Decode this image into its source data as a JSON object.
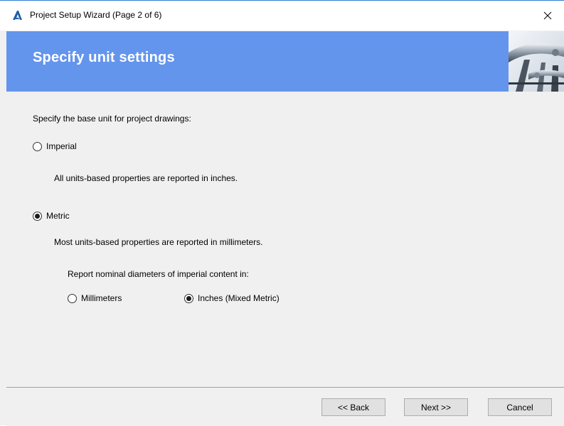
{
  "window": {
    "title": "Project Setup Wizard (Page 2 of 6)",
    "close_glyph": "✕"
  },
  "banner": {
    "title": "Specify unit settings"
  },
  "content": {
    "prompt": "Specify the base unit for project drawings:",
    "imperial": {
      "label": "Imperial",
      "checked": false,
      "description": "All units-based properties are reported in inches."
    },
    "metric": {
      "label": "Metric",
      "checked": true,
      "description": "Most units-based properties are reported in millimeters."
    },
    "nominal": {
      "prompt": "Report nominal diameters of imperial content in:",
      "millimeters": {
        "label": "Millimeters",
        "checked": false
      },
      "inches": {
        "label": "Inches (Mixed Metric)",
        "checked": true
      }
    }
  },
  "footer": {
    "back_label": "<< Back",
    "next_label": "Next >>",
    "cancel_label": "Cancel"
  },
  "colors": {
    "banner": "#6495ed",
    "window_bg": "#f0f0f0",
    "accent": "#2b7bd6"
  },
  "icons": {
    "app": "autodesk-a-icon",
    "close": "close-icon",
    "banner_image": "pipes-image"
  }
}
